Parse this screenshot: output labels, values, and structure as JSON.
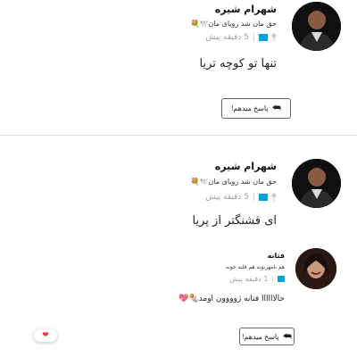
{
  "comments": [
    {
      "author": "شهرام شیره",
      "status": "حق مان شد رویای مان🕊️💐",
      "time": "5 دقیقه پیش",
      "message": "تنها تو کوچه تریا",
      "reply_label": "پاسخ میدهم!"
    },
    {
      "author": "شهرام شیره",
      "status": "حق مان شد رویای مان🕊️💐",
      "time": "5 دقیقه پیش",
      "message": "ای قشنگتر از پریا",
      "reply": {
        "author": "فتانه",
        "status": "هم نامهربونه هم قلبه خونه",
        "time": "1 دقیقه پیش",
        "message": "حالاااااا فتانه ژوووون اومد🌯💖",
        "reply_label": "پاسخ میدهم!"
      }
    }
  ],
  "like_icon": "heart-icon",
  "accent_color": "#00a3d9"
}
